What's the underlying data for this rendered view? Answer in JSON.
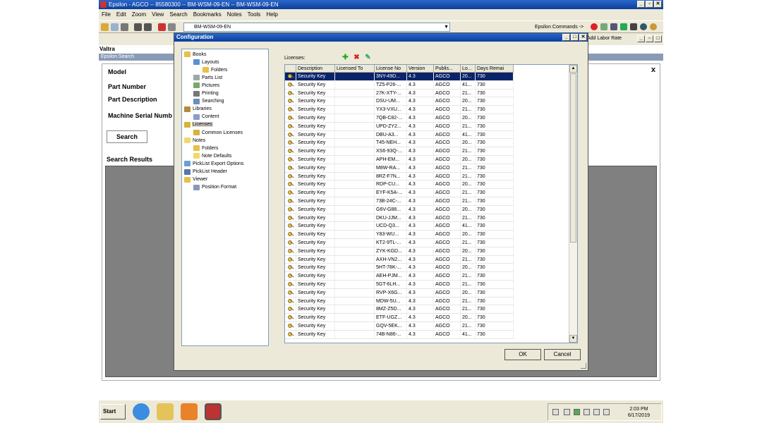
{
  "window": {
    "title": "Epsilon - AGCO -- 85580300 -- BM-WSM-09-EN -- BM-WSM-09-EN"
  },
  "menu": [
    "File",
    "Edit",
    "Zoom",
    "View",
    "Search",
    "Bookmarks",
    "Notes",
    "Tools",
    "Help"
  ],
  "toolbar": {
    "document_value": "BM-WSM-09-EN",
    "epsilon_commands": "Epsilon Commands ->",
    "add_labor_rate": "Add Labor Rate"
  },
  "background": {
    "section_title": "Valtra",
    "search_header": "Epsilon Search",
    "fields": [
      "Model",
      "Part Number",
      "Part Description",
      "Machine Serial Numb"
    ],
    "search_button": "Search",
    "close": "x",
    "results_label": "Search Results"
  },
  "dialog": {
    "title": "Configuration",
    "licenses_label": "Licenses:",
    "ok": "OK",
    "cancel": "Cancel",
    "tree": [
      {
        "label": "Books",
        "indent": 0,
        "icon": "folder-icon"
      },
      {
        "label": "Layouts",
        "indent": 1,
        "icon": "layout-icon"
      },
      {
        "label": "Folders",
        "indent": 2,
        "icon": "folder-icon"
      },
      {
        "label": "Parts List",
        "indent": 1,
        "icon": "list-icon"
      },
      {
        "label": "Pictures",
        "indent": 1,
        "icon": "picture-icon"
      },
      {
        "label": "Printing",
        "indent": 1,
        "icon": "printer-icon"
      },
      {
        "label": "Searching",
        "indent": 1,
        "icon": "search-icon"
      },
      {
        "label": "Libraries",
        "indent": 0,
        "icon": "library-icon"
      },
      {
        "label": "Content",
        "indent": 1,
        "icon": "content-icon"
      },
      {
        "label": "Licenses",
        "indent": 0,
        "icon": "key-icon",
        "selected": true
      },
      {
        "label": "Common Licenses",
        "indent": 1,
        "icon": "key-icon"
      },
      {
        "label": "Notes",
        "indent": 0,
        "icon": "note-icon"
      },
      {
        "label": "Folders",
        "indent": 1,
        "icon": "folder-icon"
      },
      {
        "label": "Note Defaults",
        "indent": 1,
        "icon": "note-icon"
      },
      {
        "label": "PickList Export Options",
        "indent": 0,
        "icon": "export-icon"
      },
      {
        "label": "PickList Header",
        "indent": 0,
        "icon": "header-icon"
      },
      {
        "label": "Viewer",
        "indent": 0,
        "icon": "folder-icon"
      },
      {
        "label": "Position Format",
        "indent": 1,
        "icon": "format-icon"
      }
    ],
    "columns": [
      "",
      "Description",
      "Licensed To",
      "License No",
      "Version",
      "Publis...",
      "Lo...",
      "Days Remai"
    ],
    "rows": [
      {
        "d": "Security Key",
        "t": "",
        "n": "3NY-49D...",
        "v": "4.3",
        "p": "AGCO",
        "l": "20...",
        "r": "730",
        "selected": true
      },
      {
        "d": "Security Key",
        "t": "",
        "n": "TZ5-P26-...",
        "v": "4.3",
        "p": "AGCO",
        "l": "41...",
        "r": "730"
      },
      {
        "d": "Security Key",
        "t": "",
        "n": "27K-XTY-...",
        "v": "4.3",
        "p": "AGCO",
        "l": "21...",
        "r": "730"
      },
      {
        "d": "Security Key",
        "t": "",
        "n": "DSU-UM...",
        "v": "4.3",
        "p": "AGCO",
        "l": "20...",
        "r": "730"
      },
      {
        "d": "Security Key",
        "t": "",
        "n": "YX3-VXU...",
        "v": "4.3",
        "p": "AGCO",
        "l": "21...",
        "r": "730"
      },
      {
        "d": "Security Key",
        "t": "",
        "n": "7QB-C82-...",
        "v": "4.3",
        "p": "AGCO",
        "l": "20...",
        "r": "730"
      },
      {
        "d": "Security Key",
        "t": "",
        "n": "UPD-ZY2...",
        "v": "4.3",
        "p": "AGCO",
        "l": "21...",
        "r": "730"
      },
      {
        "d": "Security Key",
        "t": "",
        "n": "DBU-A3...",
        "v": "4.3",
        "p": "AGCO",
        "l": "41...",
        "r": "730"
      },
      {
        "d": "Security Key",
        "t": "",
        "n": "T45-NEH...",
        "v": "4.3",
        "p": "AGCO",
        "l": "20...",
        "r": "730"
      },
      {
        "d": "Security Key",
        "t": "",
        "n": "XS6-93Q-...",
        "v": "4.3",
        "p": "AGCO",
        "l": "21...",
        "r": "730"
      },
      {
        "d": "Security Key",
        "t": "",
        "n": "APH-EM...",
        "v": "4.3",
        "p": "AGCO",
        "l": "20...",
        "r": "730"
      },
      {
        "d": "Security Key",
        "t": "",
        "n": "M8W-RA...",
        "v": "4.3",
        "p": "AGCO",
        "l": "21...",
        "r": "730"
      },
      {
        "d": "Security Key",
        "t": "",
        "n": "8RZ-F7N...",
        "v": "4.3",
        "p": "AGCO",
        "l": "21...",
        "r": "730"
      },
      {
        "d": "Security Key",
        "t": "",
        "n": "RDP-CU...",
        "v": "4.3",
        "p": "AGCO",
        "l": "20...",
        "r": "730"
      },
      {
        "d": "Security Key",
        "t": "",
        "n": "EYF-K5A-...",
        "v": "4.3",
        "p": "AGCO",
        "l": "21...",
        "r": "730"
      },
      {
        "d": "Security Key",
        "t": "",
        "n": "73B-24C-...",
        "v": "4.3",
        "p": "AGCO",
        "l": "21...",
        "r": "730"
      },
      {
        "d": "Security Key",
        "t": "",
        "n": "G6V-G88...",
        "v": "4.3",
        "p": "AGCO",
        "l": "20...",
        "r": "730"
      },
      {
        "d": "Security Key",
        "t": "",
        "n": "DKU-JJM...",
        "v": "4.3",
        "p": "AGCO",
        "l": "21...",
        "r": "730"
      },
      {
        "d": "Security Key",
        "t": "",
        "n": "UCD-Q3...",
        "v": "4.3",
        "p": "AGCO",
        "l": "41...",
        "r": "730"
      },
      {
        "d": "Security Key",
        "t": "",
        "n": "Y83-WU...",
        "v": "4.3",
        "p": "AGCO",
        "l": "20...",
        "r": "730"
      },
      {
        "d": "Security Key",
        "t": "",
        "n": "KT2-9TL-...",
        "v": "4.3",
        "p": "AGCO",
        "l": "21...",
        "r": "730"
      },
      {
        "d": "Security Key",
        "t": "",
        "n": "ZYK-KGD...",
        "v": "4.3",
        "p": "AGCO",
        "l": "20...",
        "r": "730"
      },
      {
        "d": "Security Key",
        "t": "",
        "n": "AXH-VN2...",
        "v": "4.3",
        "p": "AGCO",
        "l": "21...",
        "r": "730"
      },
      {
        "d": "Security Key",
        "t": "",
        "n": "5HT-78K-...",
        "v": "4.3",
        "p": "AGCO",
        "l": "20...",
        "r": "730"
      },
      {
        "d": "Security Key",
        "t": "",
        "n": "AEH-PJM...",
        "v": "4.3",
        "p": "AGCO",
        "l": "21...",
        "r": "730"
      },
      {
        "d": "Security Key",
        "t": "",
        "n": "5GT-6LH...",
        "v": "4.3",
        "p": "AGCO",
        "l": "21...",
        "r": "730"
      },
      {
        "d": "Security Key",
        "t": "",
        "n": "RVP-X6G...",
        "v": "4.3",
        "p": "AGCO",
        "l": "20...",
        "r": "730"
      },
      {
        "d": "Security Key",
        "t": "",
        "n": "MDW-5U...",
        "v": "4.3",
        "p": "AGCO",
        "l": "21...",
        "r": "730"
      },
      {
        "d": "Security Key",
        "t": "",
        "n": "8MZ-Z5D...",
        "v": "4.3",
        "p": "AGCO",
        "l": "21...",
        "r": "730"
      },
      {
        "d": "Security Key",
        "t": "",
        "n": "ETF-UGZ...",
        "v": "4.3",
        "p": "AGCO",
        "l": "20...",
        "r": "730"
      },
      {
        "d": "Security Key",
        "t": "",
        "n": "GQV-5EK...",
        "v": "4.3",
        "p": "AGCO",
        "l": "21...",
        "r": "730"
      },
      {
        "d": "Security Key",
        "t": "",
        "n": "74B-N86-...",
        "v": "4.3",
        "p": "AGCO",
        "l": "41...",
        "r": "730"
      }
    ]
  },
  "taskbar": {
    "start": "Start",
    "time": "2:03 PM",
    "date": "6/17/2019"
  },
  "colors": {
    "titlebar": "#0a3f9e",
    "selection": "#0a246a",
    "chrome": "#ece9d8"
  }
}
